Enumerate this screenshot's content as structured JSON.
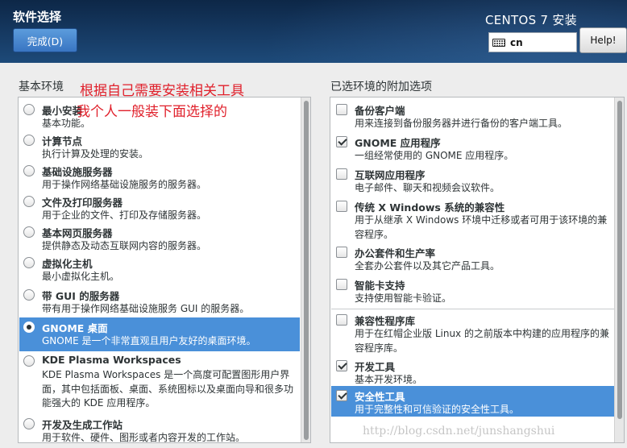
{
  "header": {
    "title": "软件选择",
    "done_label": "完成(D)",
    "product": "CENTOS 7 安装",
    "keyboard_layout": "cn",
    "help_label": "Help!"
  },
  "annotations": {
    "line1": "根据自己需要安装相关工具",
    "line2": "我个人一般装下面选择的"
  },
  "environments": {
    "title": "基本环境",
    "items": [
      {
        "name": "最小安装",
        "desc": "基本功能。",
        "selected": false
      },
      {
        "name": "计算节点",
        "desc": "执行计算及处理的安装。",
        "selected": false
      },
      {
        "name": "基础设施服务器",
        "desc": "用于操作网络基础设施服务的服务器。",
        "selected": false
      },
      {
        "name": "文件及打印服务器",
        "desc": "用于企业的文件、打印及存储服务器。",
        "selected": false
      },
      {
        "name": "基本网页服务器",
        "desc": "提供静态及动态互联网内容的服务器。",
        "selected": false
      },
      {
        "name": "虚拟化主机",
        "desc": "最小虚拟化主机。",
        "selected": false
      },
      {
        "name": "带 GUI 的服务器",
        "desc": "带有用于操作网络基础设施服务 GUI 的服务器。",
        "selected": false
      },
      {
        "name": "GNOME 桌面",
        "desc": "GNOME 是一个非常直观且用户友好的桌面环境。",
        "selected": true
      },
      {
        "name": "KDE Plasma Workspaces",
        "desc": "KDE Plasma Workspaces 是一个高度可配置图形用户界面，其中包括面板、桌面、系统图标以及桌面向导和很多功能强大的 KDE 应用程序。",
        "selected": false
      },
      {
        "name": "开发及生成工作站",
        "desc": "用于软件、硬件、图形或者内容开发的工作站。",
        "selected": false
      }
    ]
  },
  "addons": {
    "title": "已选环境的附加选项",
    "items": [
      {
        "name": "备份客户端",
        "desc": "用来连接到备份服务器并进行备份的客户端工具。",
        "checked": false,
        "selected": false
      },
      {
        "name": "GNOME 应用程序",
        "desc": "一组经常使用的 GNOME 应用程序。",
        "checked": true,
        "selected": false
      },
      {
        "name": "互联网应用程序",
        "desc": "电子邮件、聊天和视频会议软件。",
        "checked": false,
        "selected": false
      },
      {
        "name": "传统 X Windows 系统的兼容性",
        "desc": "用于从继承 X Windows 环境中迁移或者可用于该环境的兼容程序。",
        "checked": false,
        "selected": false
      },
      {
        "name": "办公套件和生产率",
        "desc": "全套办公套件以及其它产品工具。",
        "checked": false,
        "selected": false
      },
      {
        "name": "智能卡支持",
        "desc": "支持使用智能卡验证。",
        "checked": false,
        "selected": false
      },
      {
        "name": "兼容性程序库",
        "desc": "用于在红帽企业版 Linux 的之前版本中构建的应用程序的兼容程序库。",
        "checked": false,
        "selected": false
      },
      {
        "name": "开发工具",
        "desc": "基本开发环境。",
        "checked": true,
        "selected": false
      },
      {
        "name": "安全性工具",
        "desc": "用于完整性和可信验证的安全性工具。",
        "checked": true,
        "selected": true
      }
    ]
  },
  "watermark": "http://blog.csdn.net/junshangshui",
  "colors": {
    "header_bg": "#163a63",
    "selection": "#4a90d9",
    "annotation": "#e0202b",
    "done_button": "#4a87cf"
  }
}
